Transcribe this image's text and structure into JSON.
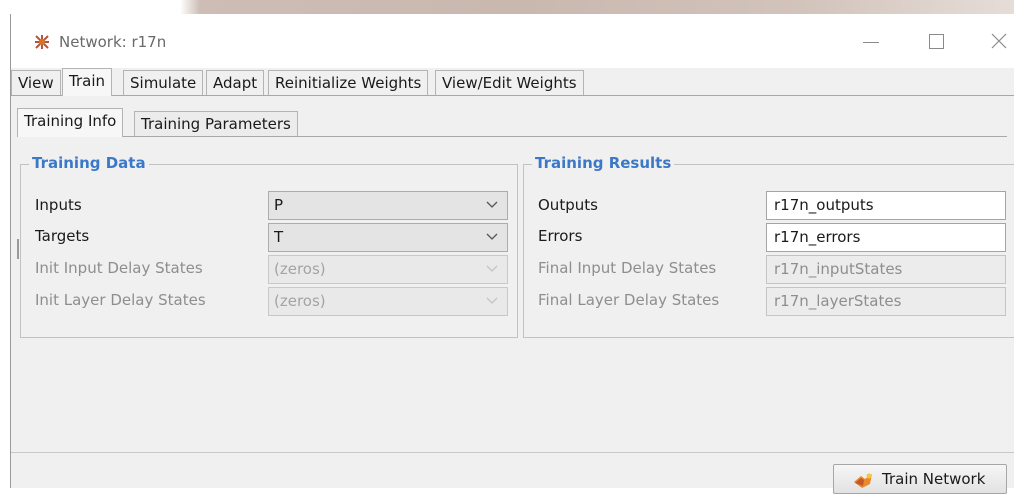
{
  "window": {
    "title": "Network: r17n",
    "minimize_icon": "minimize-icon",
    "maximize_icon": "maximize-icon",
    "close_icon": "close-icon"
  },
  "main_tabs": [
    {
      "label": "View",
      "active": false
    },
    {
      "label": "Train",
      "active": true
    },
    {
      "label": "Simulate",
      "active": false
    },
    {
      "label": "Adapt",
      "active": false
    },
    {
      "label": "Reinitialize Weights",
      "active": false
    },
    {
      "label": "View/Edit Weights",
      "active": false
    }
  ],
  "sub_tabs": [
    {
      "label": "Training Info",
      "active": true
    },
    {
      "label": "Training Parameters",
      "active": false
    }
  ],
  "training_data": {
    "title": "Training Data",
    "rows": [
      {
        "label": "Inputs",
        "value": "P",
        "enabled": true
      },
      {
        "label": "Targets",
        "value": "T",
        "enabled": true
      },
      {
        "label": "Init Input Delay States",
        "value": "(zeros)",
        "enabled": false
      },
      {
        "label": "Init Layer Delay States",
        "value": "(zeros)",
        "enabled": false
      }
    ]
  },
  "training_results": {
    "title": "Training Results",
    "rows": [
      {
        "label": "Outputs",
        "value": "r17n_outputs",
        "enabled": true
      },
      {
        "label": "Errors",
        "value": "r17n_errors",
        "enabled": true
      },
      {
        "label": "Final Input Delay States",
        "value": "r17n_inputStates",
        "enabled": false
      },
      {
        "label": "Final Layer Delay States",
        "value": "r17n_layerStates",
        "enabled": false
      }
    ]
  },
  "actions": {
    "train_label": "Train Network",
    "train_icon": "train-network-icon"
  },
  "colors": {
    "group_title": "#3c78c8",
    "panel_bg": "#f0f0f0",
    "disabled_text": "#8e8e8e"
  }
}
